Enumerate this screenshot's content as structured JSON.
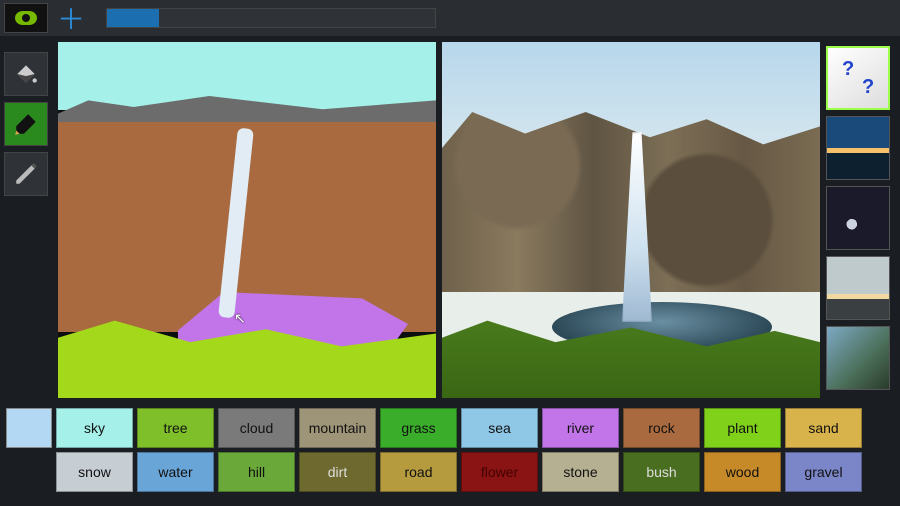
{
  "topbar": {
    "progress_percent": 16
  },
  "tools": {
    "fill": "fill",
    "brush": "brush",
    "pencil": "pencil",
    "active": "brush"
  },
  "thumbs": {
    "random": "random-dice",
    "active_index": 0
  },
  "palette": {
    "current_color": "#b2d8f3",
    "row1": [
      {
        "label": "sky",
        "bg": "#a5f0e8",
        "fg": "#111"
      },
      {
        "label": "tree",
        "bg": "#7fbf2a",
        "fg": "#111"
      },
      {
        "label": "cloud",
        "bg": "#7a7a7a",
        "fg": "#111"
      },
      {
        "label": "mountain",
        "bg": "#9e9478",
        "fg": "#111"
      },
      {
        "label": "grass",
        "bg": "#3aae2a",
        "fg": "#111"
      },
      {
        "label": "sea",
        "bg": "#8fc8e6",
        "fg": "#111"
      },
      {
        "label": "river",
        "bg": "#c175e8",
        "fg": "#111"
      },
      {
        "label": "rock",
        "bg": "#a86a3e",
        "fg": "#111"
      },
      {
        "label": "plant",
        "bg": "#7fd11a",
        "fg": "#111"
      },
      {
        "label": "sand",
        "bg": "#d8b24a",
        "fg": "#111"
      }
    ],
    "row2": [
      {
        "label": "snow",
        "bg": "#c6cdd3",
        "fg": "#111"
      },
      {
        "label": "water",
        "bg": "#6aa5d8",
        "fg": "#111"
      },
      {
        "label": "hill",
        "bg": "#6aa83a",
        "fg": "#111"
      },
      {
        "label": "dirt",
        "bg": "#6e6a2f",
        "fg": "#ddd"
      },
      {
        "label": "road",
        "bg": "#b59a3e",
        "fg": "#111"
      },
      {
        "label": "flower",
        "bg": "#8a1414",
        "fg": "#400"
      },
      {
        "label": "stone",
        "bg": "#b6b092",
        "fg": "#111"
      },
      {
        "label": "bush",
        "bg": "#4a6e20",
        "fg": "#ddd"
      },
      {
        "label": "wood",
        "bg": "#c78a28",
        "fg": "#111"
      },
      {
        "label": "gravel",
        "bg": "#7a86c8",
        "fg": "#111"
      }
    ]
  }
}
